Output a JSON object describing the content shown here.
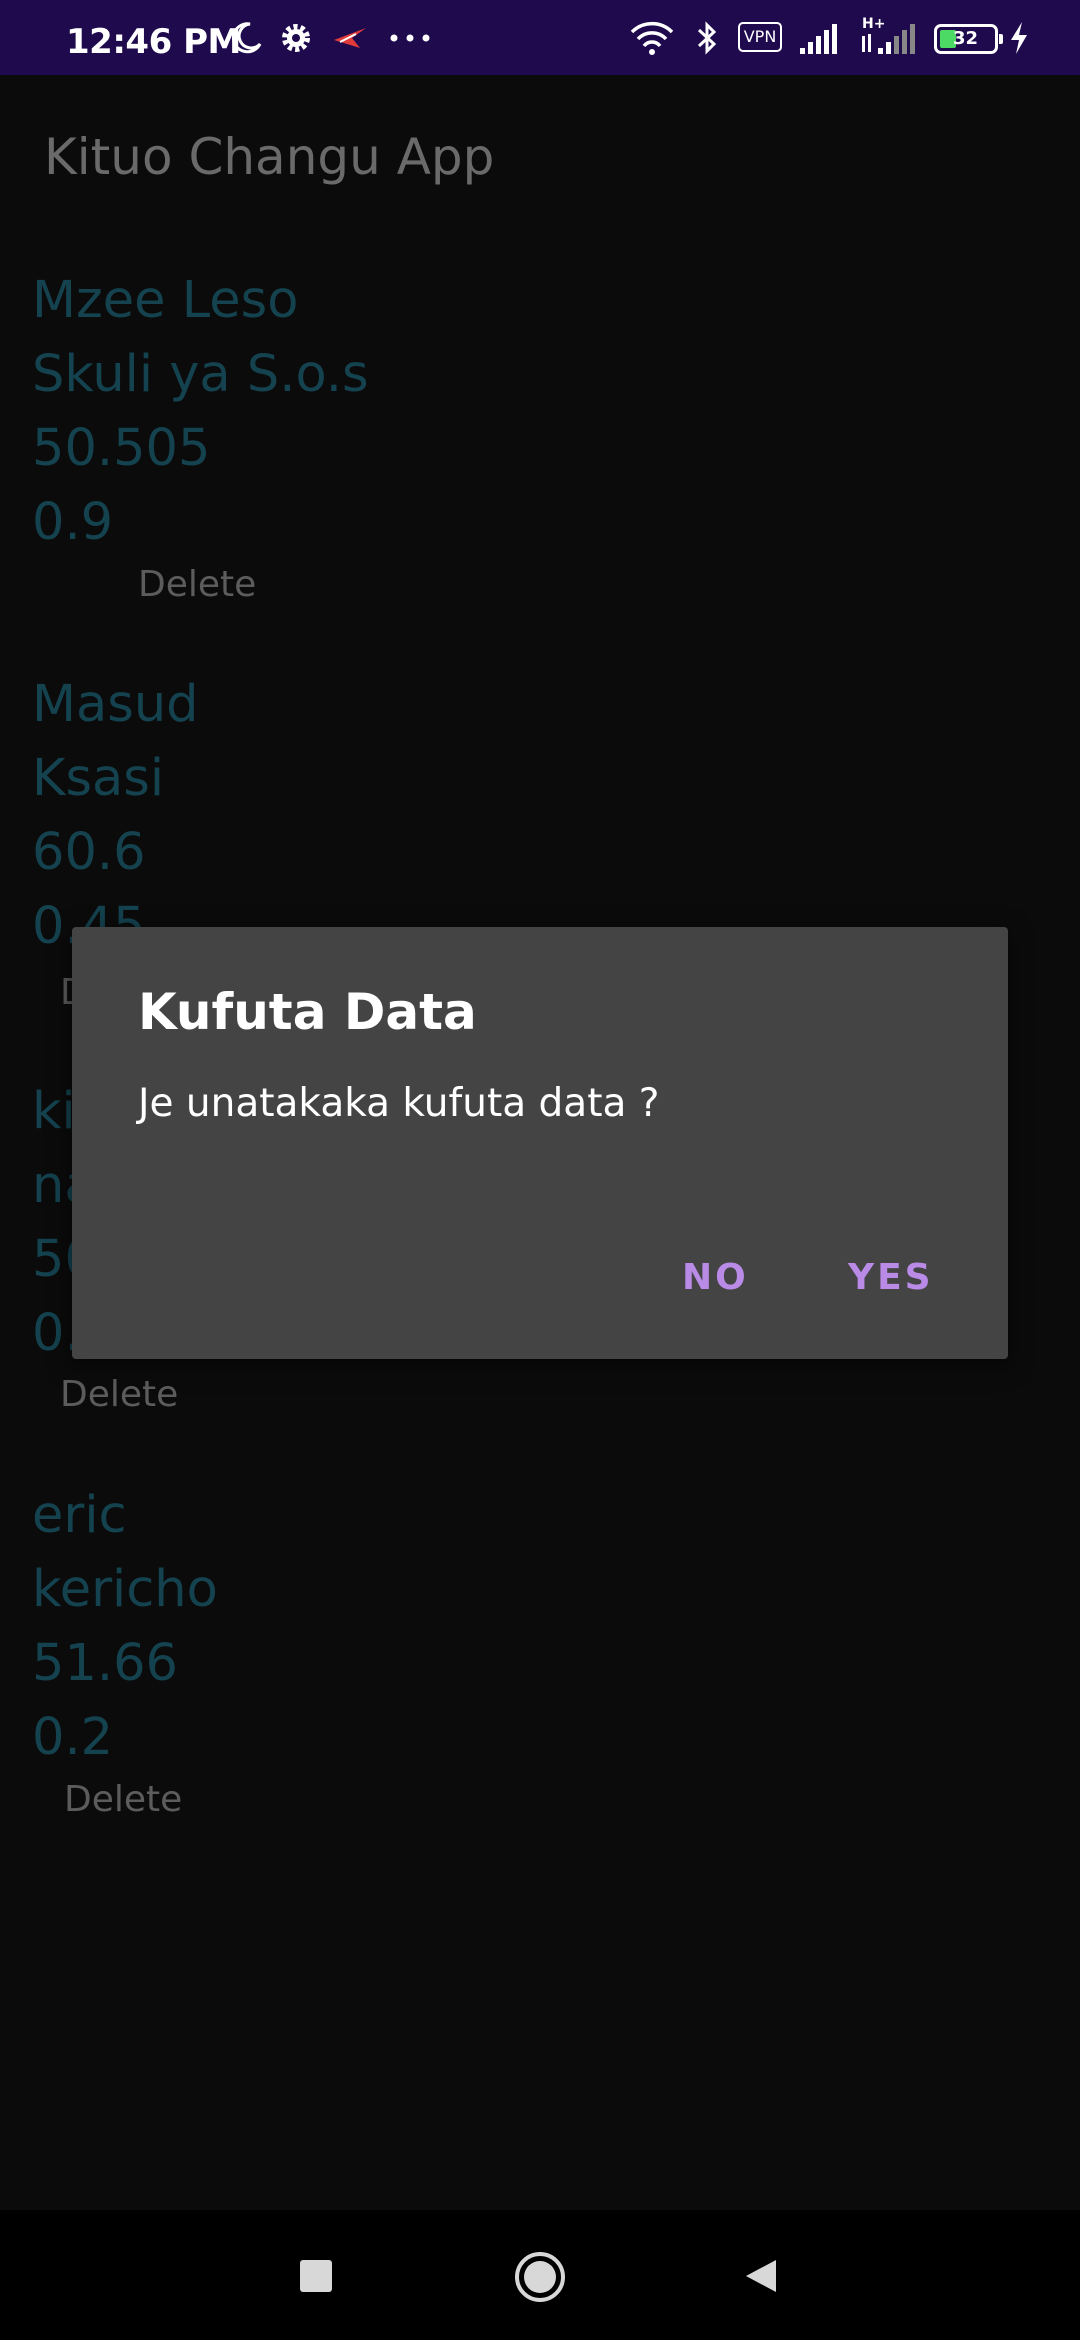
{
  "status_bar": {
    "time": "12:46 PM",
    "left_icons": [
      "moon-icon",
      "gear-icon",
      "app-notification-icon",
      "more-dots-icon"
    ],
    "right_icons": [
      "wifi-icon",
      "bluetooth-icon",
      "vpn-icon",
      "signal-icon",
      "signal-hplus-icon",
      "battery-icon",
      "charging-icon"
    ],
    "vpn_label": "VPN",
    "network_label": "H+",
    "battery_level": "32",
    "background": "#1f0a4e"
  },
  "app": {
    "title": "Kituo Changu App"
  },
  "entries": [
    {
      "name": "Mzee Leso",
      "place": "Skuli ya S.o.s",
      "value1": "50.505",
      "value2": "0.9",
      "delete_label": "Delete"
    },
    {
      "name": "Masud",
      "place": "Ksasi",
      "value1": "60.6",
      "value2": "0.45",
      "delete_label": "D"
    },
    {
      "name": "ki",
      "place": "na",
      "value1": "50",
      "value2": "0.",
      "delete_label": "Delete"
    },
    {
      "name": "eric",
      "place": "kericho",
      "value1": "51.66",
      "value2": "0.2",
      "delete_label": "Delete"
    }
  ],
  "dialog": {
    "title": "Kufuta Data",
    "message": "Je unatakaka kufuta data ?",
    "negative_label": "NO",
    "positive_label": "YES",
    "accent": "#b98ae6"
  },
  "nav_bar": {
    "icons": [
      "recents-square-icon",
      "home-circle-icon",
      "back-triangle-icon"
    ]
  },
  "colors": {
    "background": "#0b0b0b",
    "entry_text": "#14424f",
    "dialog_bg": "#444444"
  }
}
